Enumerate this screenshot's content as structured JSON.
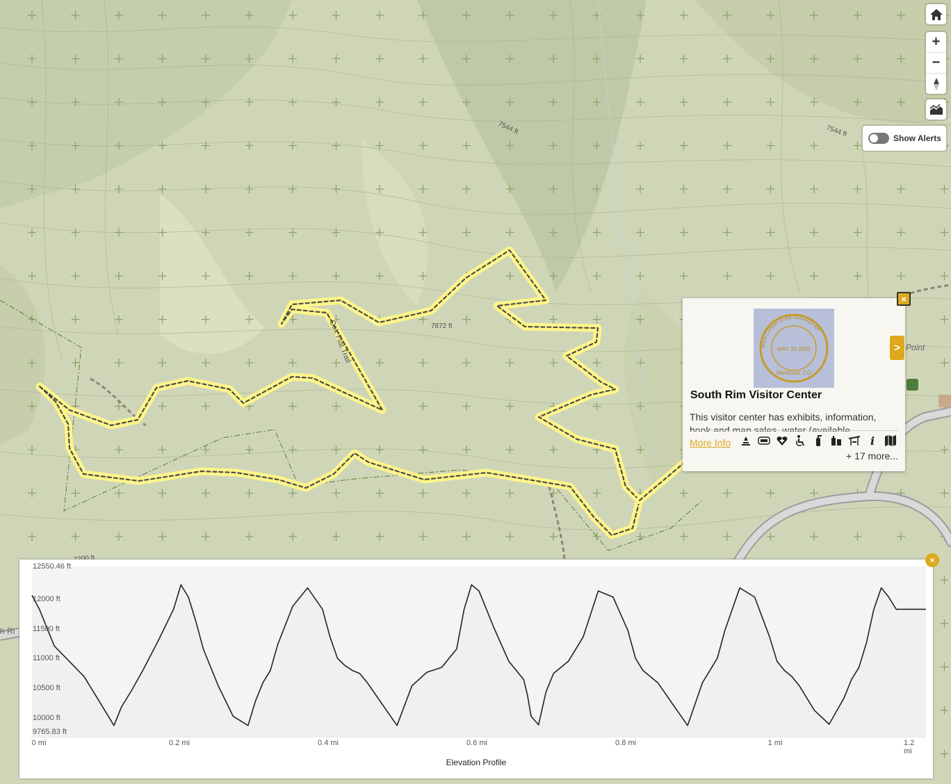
{
  "map": {
    "contour_labels": [
      "7544 ft",
      "7544 ft",
      "7872 ft",
      "7200 ft"
    ],
    "trail_label": "Oak Flat Trail",
    "point_label_fragment": "Point",
    "edge_road_fragment": "h Ri",
    "colors": {
      "terrain": "#cfd6b8",
      "trail_highlight": "#fff58a",
      "accent": "#dca91b"
    }
  },
  "controls": {
    "home_icon": "home-icon",
    "zoom_in": "+",
    "zoom_out": "−",
    "compass_icon": "compass-icon",
    "elevation_icon": "elevation-profile-icon",
    "alerts_label": "Show Alerts"
  },
  "popup": {
    "stamp_text_top": "Black Canyon of the Gunnison NP",
    "stamp_date": "MAY 19 2020",
    "stamp_text_bottom": "Montrose, CO",
    "title": "South Rim Visitor Center",
    "description": "This visitor center has exhibits, information, book and map sales, water (available",
    "more_info": "More Info",
    "amenities": [
      "campfire-icon",
      "accessible-icon",
      "first-aid-icon",
      "wheelchair-icon",
      "fire-extinguisher-icon",
      "water-icon",
      "restroom-icon",
      "picnic-shelter-icon",
      "information-icon",
      "map-icon"
    ],
    "more_count": "+ 17 more...",
    "close": "×",
    "next": ">"
  },
  "elevation": {
    "title": "Elevation Profile",
    "close": "×",
    "y_max_label": "12550.46 ft",
    "y_min_label": "9765.83 ft",
    "y_ticks": [
      "12000 ft",
      "11500 ft",
      "11000 ft",
      "10500 ft",
      "10000 ft"
    ],
    "x_ticks": [
      "0 mi",
      "0.2 mi",
      "0.4 mi",
      "0.6 mi",
      "0.8 mi",
      "1 mi",
      "1.2 mi"
    ]
  },
  "chart_data": {
    "type": "area",
    "title": "Elevation Profile",
    "xlabel": "",
    "ylabel": "",
    "xlim": [
      0,
      1.2
    ],
    "ylim": [
      9765.83,
      12550.46
    ],
    "x": [
      0,
      0.01,
      0.03,
      0.05,
      0.07,
      0.09,
      0.11,
      0.12,
      0.135,
      0.15,
      0.17,
      0.19,
      0.2,
      0.21,
      0.22,
      0.23,
      0.24,
      0.25,
      0.27,
      0.29,
      0.3,
      0.31,
      0.32,
      0.33,
      0.35,
      0.37,
      0.39,
      0.4,
      0.41,
      0.42,
      0.43,
      0.44,
      0.45,
      0.47,
      0.49,
      0.51,
      0.53,
      0.55,
      0.57,
      0.58,
      0.59,
      0.6,
      0.62,
      0.64,
      0.66,
      0.665,
      0.67,
      0.68,
      0.69,
      0.7,
      0.72,
      0.74,
      0.76,
      0.78,
      0.8,
      0.81,
      0.82,
      0.84,
      0.86,
      0.88,
      0.89,
      0.9,
      0.91,
      0.92,
      0.93,
      0.95,
      0.97,
      0.99,
      1.0,
      1.01,
      1.02,
      1.03,
      1.05,
      1.07,
      1.09,
      1.1,
      1.11,
      1.12,
      1.13,
      1.14,
      1.15,
      1.16,
      1.17,
      1.18,
      1.19,
      1.2
    ],
    "y": [
      12080,
      11850,
      11250,
      11000,
      10750,
      10350,
      9950,
      10250,
      10550,
      10880,
      11350,
      11850,
      12250,
      12050,
      11650,
      11200,
      10900,
      10600,
      10100,
      9950,
      10350,
      10650,
      10850,
      11280,
      11900,
      12200,
      11850,
      11400,
      11050,
      10930,
      10850,
      10800,
      10650,
      10300,
      9950,
      10600,
      10820,
      10900,
      11200,
      11850,
      12250,
      12150,
      11550,
      11000,
      10700,
      10450,
      10100,
      9960,
      10500,
      10800,
      11000,
      11400,
      12150,
      12050,
      11500,
      11050,
      10850,
      10650,
      10300,
      9950,
      10300,
      10650,
      10850,
      11050,
      11500,
      12200,
      12050,
      11400,
      11000,
      10850,
      10750,
      10600,
      10200,
      9970,
      10400,
      10700,
      10900,
      11300,
      11850,
      12200,
      12050,
      11850,
      11850,
      11850,
      11850,
      11850
    ]
  }
}
